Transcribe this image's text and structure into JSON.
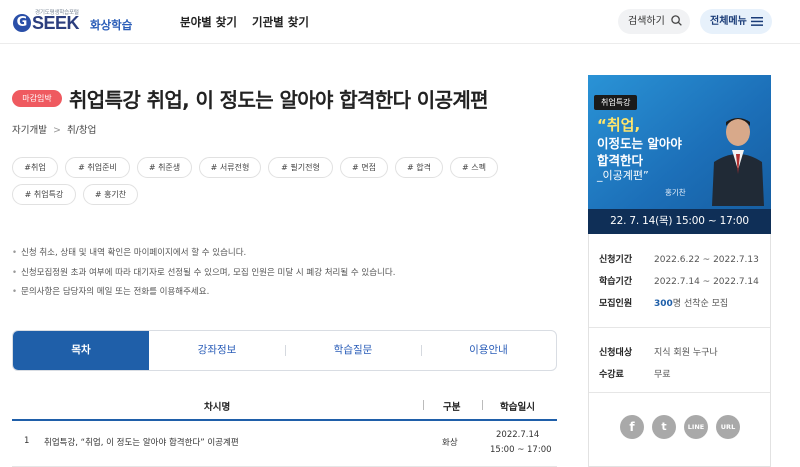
{
  "header": {
    "logo_small": "경기도평생학습포털",
    "logo_g": "G",
    "logo_seek": "SEEK",
    "logo_sub": "화상학습",
    "nav": [
      "분야별 찾기",
      "기관별 찾기"
    ],
    "search_label": "검색하기",
    "menu_label": "전체메뉴"
  },
  "course": {
    "status_badge": "마감임박",
    "title": "취업특강 취업, 이 정도는 알아야 합격한다 이공계편",
    "breadcrumb": [
      "자기개발",
      "취/창업"
    ],
    "tags": [
      "#취업",
      "# 취업준비",
      "# 취준생",
      "# 서류전형",
      "# 필기전형",
      "# 면접",
      "# 합격",
      "# 스펙",
      "# 취업특강",
      "# 홍기찬"
    ],
    "notices": [
      "신청 취소, 상태 및 내역 확인은 마이페이지에서 할 수 있습니다.",
      "신청모집정원 초과 여부에 따라 대기자로 선정될 수 있으며, 모집 인원은 미달 시 폐강 처리될 수 있습니다.",
      "문의사항은 담당자의 메일 또는 전화를 이용해주세요."
    ]
  },
  "tabs": [
    "목차",
    "강좌정보",
    "학습질문",
    "이용안내"
  ],
  "table": {
    "headers": [
      "차시명",
      "구분",
      "학습일시"
    ],
    "rows": [
      {
        "no": "1",
        "name": "취업특강, “취업, 이 정도는 알아야 합격한다” 이공계편",
        "type": "화상",
        "date": "2022.7.14",
        "time": "15:00 ~ 17:00"
      }
    ]
  },
  "sidebar": {
    "thumb": {
      "badge": "취업특강",
      "line1": "“취업,",
      "line2": "이정도는 알아야",
      "line3": "합격한다",
      "line4": "_이공계편”",
      "name": "홍기찬",
      "date": "22. 7. 14(목) 15:00 ~ 17:00"
    },
    "info": [
      {
        "label": "신청기간",
        "value": "2022.6.22 ~ 2022.7.13"
      },
      {
        "label": "학습기간",
        "value": "2022.7.14 ~ 2022.7.14"
      },
      {
        "label": "모집인원",
        "value_num": "300",
        "value": "명 선착순 모집"
      },
      {
        "label": "신청대상",
        "value": "지식 회원 누구나"
      },
      {
        "label": "수강료",
        "value": "무료"
      }
    ],
    "share": [
      "f",
      "t",
      "LINE",
      "URL"
    ]
  },
  "colors": {
    "primary": "#1f5fa9",
    "badge": "#ef5a60",
    "thumb_bg": "#1c6fb8"
  }
}
